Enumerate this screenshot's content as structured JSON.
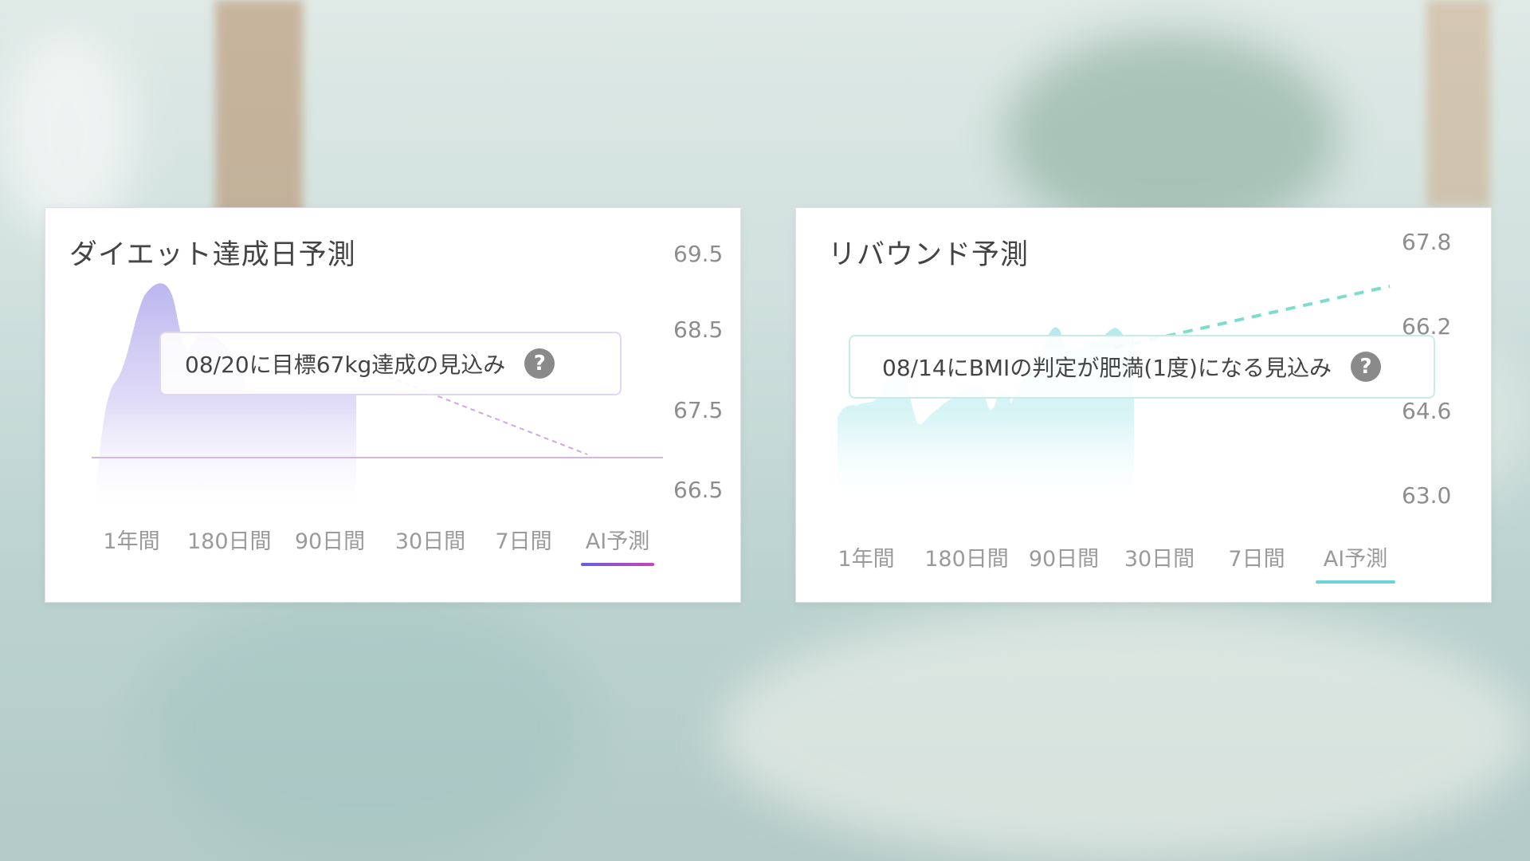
{
  "panels": [
    {
      "title": "ダイエット達成日予測",
      "callout": "08/20に目標67kg達成の見込み",
      "help_icon": "?",
      "y_ticks": [
        "69.5",
        "68.5",
        "67.5",
        "66.5"
      ],
      "tabs": [
        "1年間",
        "180日間",
        "90日間",
        "30日間",
        "7日間",
        "AI予測"
      ],
      "active_tab": "AI予測",
      "colors": {
        "area": "#c9c3f2",
        "line": "#d0a6e3",
        "accent": "#b556d1"
      }
    },
    {
      "title": "リバウンド予測",
      "callout": "08/14にBMIの判定が肥満(1度)になる見込み",
      "help_icon": "?",
      "y_ticks": [
        "67.8",
        "66.2",
        "64.6",
        "63.0"
      ],
      "tabs": [
        "1年間",
        "180日間",
        "90日間",
        "30日間",
        "7日間",
        "AI予測"
      ],
      "active_tab": "AI予測",
      "colors": {
        "area": "#bfeef0",
        "line": "#7edccc",
        "accent": "#6fd1d9"
      }
    }
  ]
}
